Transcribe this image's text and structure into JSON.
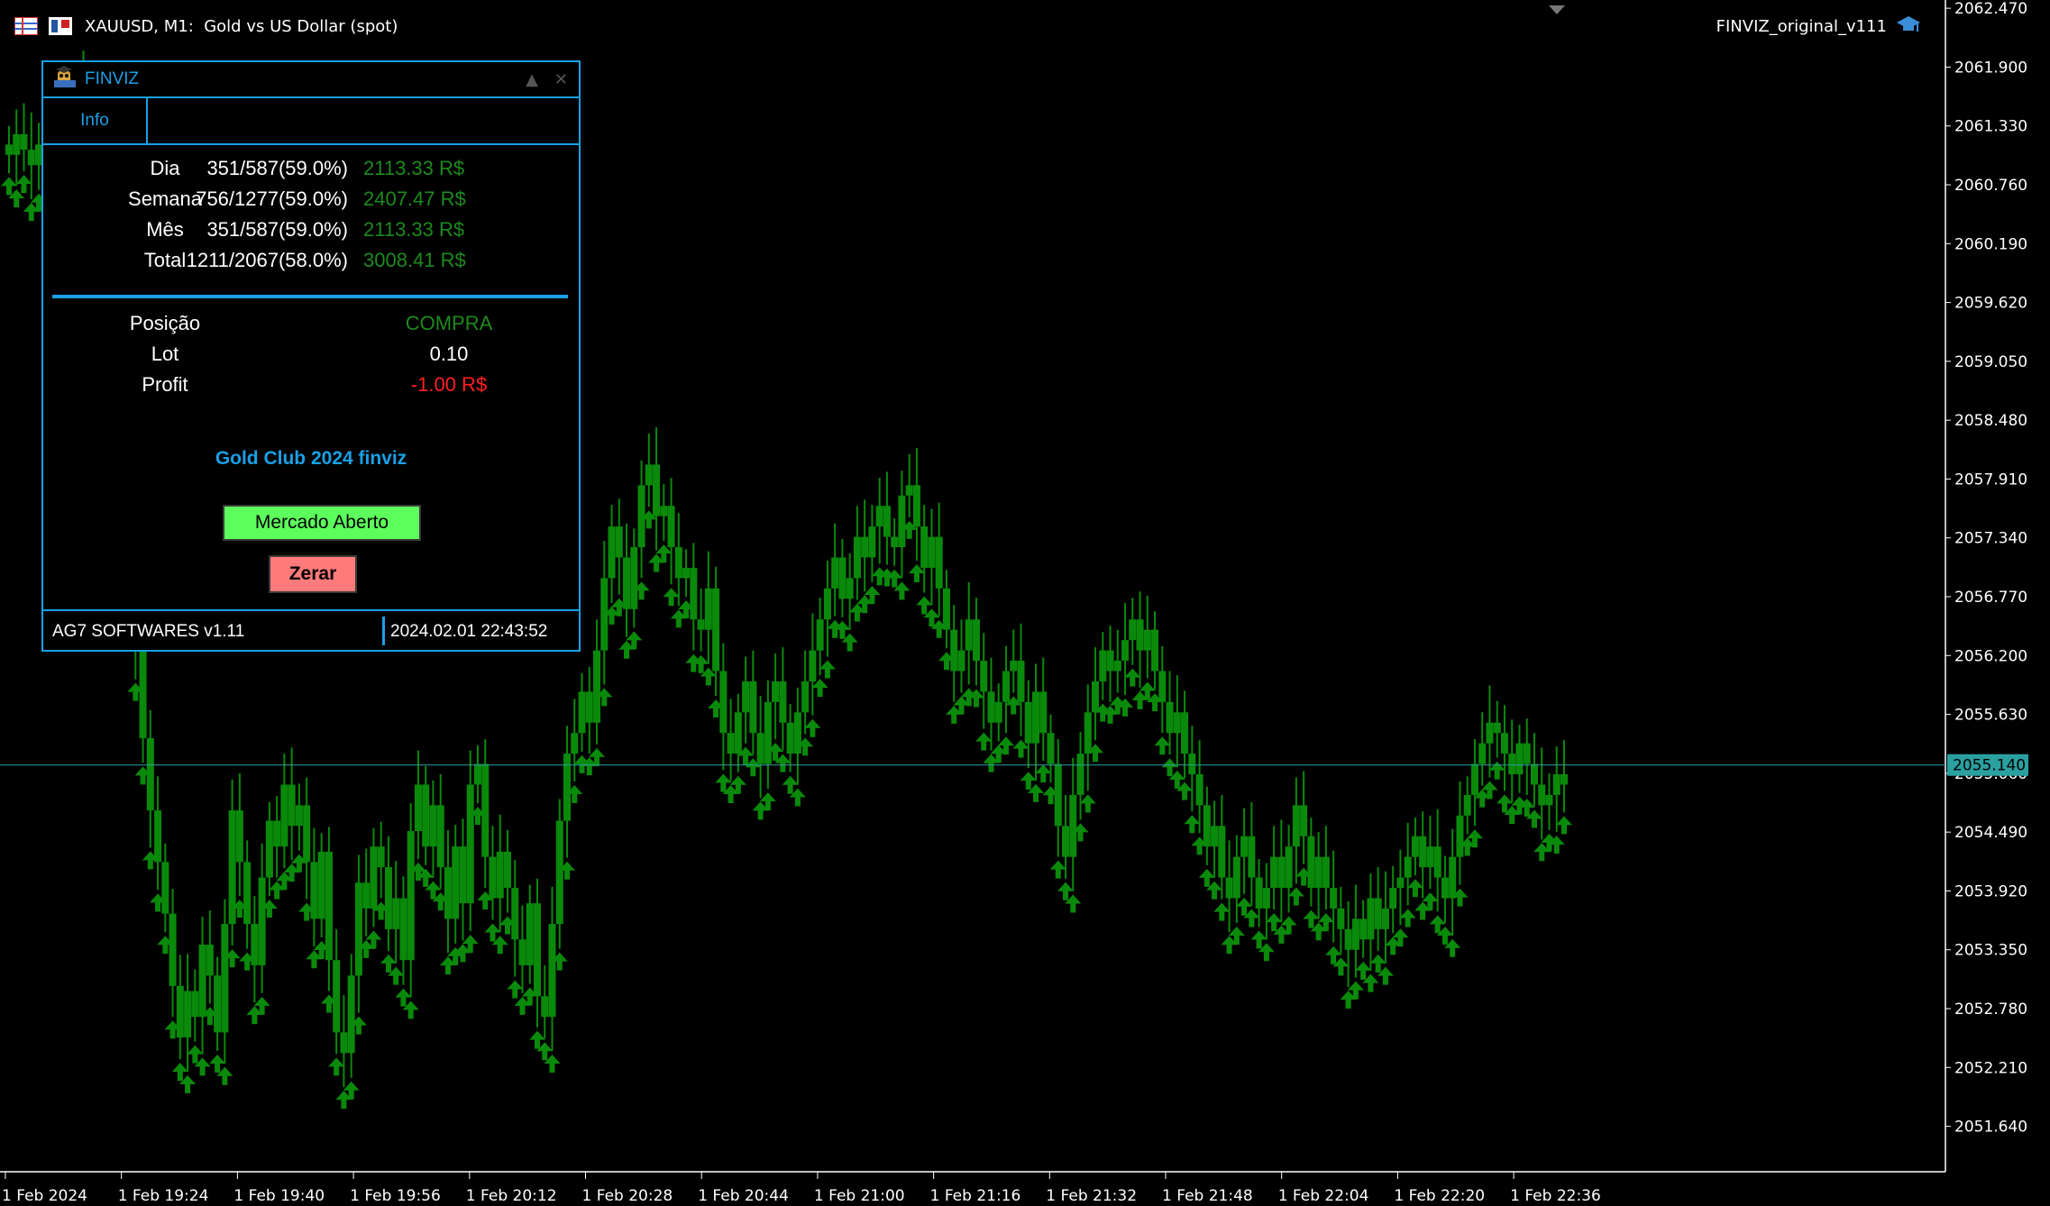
{
  "window": {
    "title": "XAUUSD, M1:  Gold vs US Dollar (spot)",
    "ea_name": "FINVIZ_original_v111"
  },
  "colors": {
    "background": "#000000",
    "candle": "#0a8a0a",
    "arrow": "#0a8a0a",
    "bid_line": "#2aa0a0",
    "price_tag_bg": "#2aa0a0",
    "panel_border": "#1aa0e6",
    "money_green": "#1d8a1d",
    "loss_red": "#ff2020"
  },
  "panel": {
    "title": "FINVIZ",
    "tab": "Info",
    "stats": [
      {
        "label": "Dia",
        "value": "351/587(59.0%)",
        "money": "2113.33 R$"
      },
      {
        "label": "Semana",
        "value": "756/1277(59.0%)",
        "money": "2407.47 R$"
      },
      {
        "label": "Mês",
        "value": "351/587(59.0%)",
        "money": "2113.33 R$"
      },
      {
        "label": "Total",
        "value": "1211/2067(58.0%)",
        "money": "3008.41 R$"
      }
    ],
    "position": {
      "position_label": "Posição",
      "position_value": "COMPRA",
      "lot_label": "Lot",
      "lot_value": "0.10",
      "profit_label": "Profit",
      "profit_value": "-1.00 R$"
    },
    "brand": "Gold Club 2024 finviz",
    "market_button": "Mercado Aberto",
    "close_button": "Zerar",
    "footer_left": "AG7 SOFTWARES v1.11",
    "footer_right": "2024.02.01 22:43:52"
  },
  "chart_data": {
    "type": "candlestick",
    "symbol": "XAUUSD",
    "timeframe": "M1",
    "current_price": "2055.140",
    "price_ticks": [
      "2062.470",
      "2061.900",
      "2061.330",
      "2060.760",
      "2060.190",
      "2059.620",
      "2059.050",
      "2058.480",
      "2057.910",
      "2057.340",
      "2056.770",
      "2056.200",
      "2055.630",
      "2055.060",
      "2054.490",
      "2053.920",
      "2053.350",
      "2052.780",
      "2052.210",
      "2051.640"
    ],
    "time_ticks": [
      "1 Feb 2024",
      "1 Feb 19:24",
      "1 Feb 19:40",
      "1 Feb 19:56",
      "1 Feb 20:12",
      "1 Feb 20:28",
      "1 Feb 20:44",
      "1 Feb 21:00",
      "1 Feb 21:16",
      "1 Feb 21:32",
      "1 Feb 21:48",
      "1 Feb 22:04",
      "1 Feb 22:20",
      "1 Feb 22:36"
    ],
    "ylim": [
      2051.2,
      2062.55
    ],
    "closes": [
      2061.05,
      2061.25,
      2061.1,
      2060.95,
      2061.15,
      2061.05,
      2060.85,
      2061.35,
      2061.6,
      2061.45,
      2061.7,
      2061.5,
      2060.9,
      2060.4,
      2059.5,
      2058.4,
      2057.2,
      2056.3,
      2055.4,
      2054.7,
      2054.2,
      2053.7,
      2053.0,
      2052.5,
      2052.95,
      2052.7,
      2053.4,
      2053.1,
      2052.55,
      2053.6,
      2054.7,
      2054.2,
      2053.6,
      2053.2,
      2054.05,
      2054.6,
      2054.35,
      2054.95,
      2054.55,
      2054.75,
      2054.2,
      2053.65,
      2054.3,
      2053.25,
      2052.55,
      2052.35,
      2053.1,
      2054.0,
      2053.75,
      2054.35,
      2054.15,
      2053.55,
      2053.85,
      2053.25,
      2054.5,
      2054.95,
      2054.35,
      2054.75,
      2054.15,
      2053.65,
      2054.35,
      2053.8,
      2054.95,
      2055.15,
      2054.25,
      2053.85,
      2054.3,
      2053.95,
      2053.45,
      2053.2,
      2053.8,
      2052.9,
      2052.7,
      2053.6,
      2054.6,
      2055.25,
      2055.45,
      2055.85,
      2055.55,
      2056.25,
      2056.95,
      2057.45,
      2057.15,
      2056.65,
      2057.25,
      2057.85,
      2058.05,
      2057.55,
      2057.65,
      2057.25,
      2056.95,
      2057.05,
      2056.55,
      2056.45,
      2056.85,
      2056.05,
      2055.45,
      2055.25,
      2055.65,
      2055.95,
      2055.45,
      2055.15,
      2055.75,
      2055.95,
      2055.55,
      2055.25,
      2055.65,
      2055.95,
      2056.25,
      2056.55,
      2056.85,
      2057.15,
      2056.75,
      2056.95,
      2057.35,
      2057.15,
      2057.45,
      2057.65,
      2057.35,
      2057.25,
      2057.75,
      2057.85,
      2057.45,
      2057.05,
      2057.35,
      2056.85,
      2056.45,
      2056.05,
      2056.25,
      2056.55,
      2056.15,
      2055.85,
      2055.55,
      2055.75,
      2056.05,
      2056.15,
      2055.75,
      2055.35,
      2055.85,
      2055.45,
      2055.15,
      2054.55,
      2054.25,
      2054.85,
      2055.25,
      2055.65,
      2055.95,
      2056.25,
      2056.05,
      2056.15,
      2056.35,
      2056.55,
      2056.25,
      2056.45,
      2056.05,
      2055.75,
      2055.45,
      2055.65,
      2055.25,
      2055.05,
      2054.75,
      2054.35,
      2054.55,
      2054.05,
      2053.85,
      2054.25,
      2054.45,
      2054.05,
      2053.75,
      2053.95,
      2054.25,
      2053.95,
      2054.35,
      2054.75,
      2054.45,
      2053.95,
      2054.25,
      2053.95,
      2053.75,
      2053.55,
      2053.35,
      2053.65,
      2053.45,
      2053.85,
      2053.55,
      2053.75,
      2053.95,
      2054.05,
      2054.25,
      2054.45,
      2054.15,
      2054.35,
      2054.05,
      2053.85,
      2054.25,
      2054.65,
      2054.85,
      2055.15,
      2055.35,
      2055.55,
      2055.45,
      2055.25,
      2055.05,
      2055.35,
      2055.15,
      2054.95,
      2054.75,
      2054.85,
      2055.05,
      2054.95
    ]
  }
}
